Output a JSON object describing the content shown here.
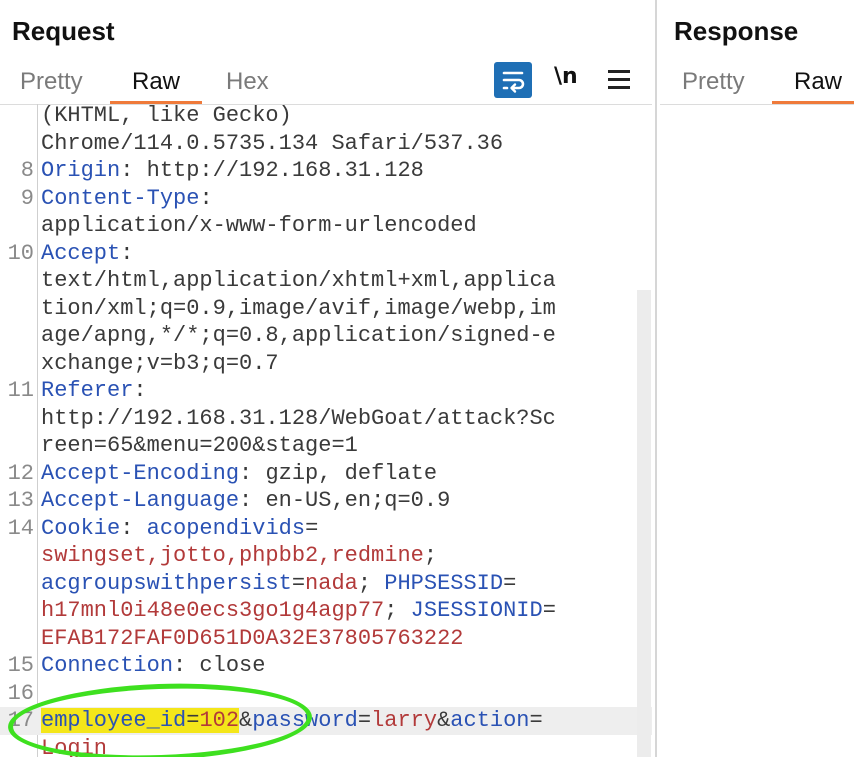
{
  "request": {
    "title": "Request",
    "tabs": [
      {
        "label": "Pretty",
        "active": false
      },
      {
        "label": "Raw",
        "active": true
      },
      {
        "label": "Hex",
        "active": false
      }
    ],
    "toolbar": {
      "newline_label": "\\n"
    }
  },
  "response": {
    "title": "Response",
    "tabs": [
      {
        "label": "Pretty",
        "active": false
      },
      {
        "label": "Raw",
        "active": true
      }
    ]
  },
  "lines": [
    {
      "n": "",
      "parts": [
        {
          "t": "(KHTML, like Gecko)",
          "c": "v"
        }
      ]
    },
    {
      "n": "",
      "parts": [
        {
          "t": "Chrome/114.0.5735.134 Safari/537.36",
          "c": "v"
        }
      ]
    },
    {
      "n": "8",
      "parts": [
        {
          "t": "Origin",
          "c": "k"
        },
        {
          "t": ": http://192.168.31.128",
          "c": "v"
        }
      ]
    },
    {
      "n": "9",
      "parts": [
        {
          "t": "Content-Type",
          "c": "k"
        },
        {
          "t": ":",
          "c": "v"
        }
      ]
    },
    {
      "n": "",
      "parts": [
        {
          "t": "application/x-www-form-urlencoded",
          "c": "v"
        }
      ]
    },
    {
      "n": "10",
      "parts": [
        {
          "t": "Accept",
          "c": "k"
        },
        {
          "t": ":",
          "c": "v"
        }
      ]
    },
    {
      "n": "",
      "parts": [
        {
          "t": "text/html,application/xhtml+xml,applica",
          "c": "v"
        }
      ]
    },
    {
      "n": "",
      "parts": [
        {
          "t": "tion/xml;q=0.9,image/avif,image/webp,im",
          "c": "v"
        }
      ]
    },
    {
      "n": "",
      "parts": [
        {
          "t": "age/apng,*/*;q=0.8,application/signed-e",
          "c": "v"
        }
      ]
    },
    {
      "n": "",
      "parts": [
        {
          "t": "xchange;v=b3;q=0.7",
          "c": "v"
        }
      ]
    },
    {
      "n": "11",
      "parts": [
        {
          "t": "Referer",
          "c": "k"
        },
        {
          "t": ":",
          "c": "v"
        }
      ]
    },
    {
      "n": "",
      "parts": [
        {
          "t": "http://192.168.31.128/WebGoat/attack?Sc",
          "c": "v"
        }
      ]
    },
    {
      "n": "",
      "parts": [
        {
          "t": "reen=65&menu=200&stage=1",
          "c": "v"
        }
      ]
    },
    {
      "n": "12",
      "parts": [
        {
          "t": "Accept-Encoding",
          "c": "k"
        },
        {
          "t": ": gzip, deflate",
          "c": "v"
        }
      ]
    },
    {
      "n": "13",
      "parts": [
        {
          "t": "Accept-Language",
          "c": "k"
        },
        {
          "t": ": en-US,en;q=0.9",
          "c": "v"
        }
      ]
    },
    {
      "n": "14",
      "parts": [
        {
          "t": "Cookie",
          "c": "k"
        },
        {
          "t": ": ",
          "c": "v"
        },
        {
          "t": "acopendivids",
          "c": "k"
        },
        {
          "t": "=",
          "c": "v"
        }
      ]
    },
    {
      "n": "",
      "parts": [
        {
          "t": "swingset,jotto,phpbb2,redmine",
          "c": "c"
        },
        {
          "t": ";",
          "c": "v"
        }
      ]
    },
    {
      "n": "",
      "parts": [
        {
          "t": "acgroupswithpersist",
          "c": "k"
        },
        {
          "t": "=",
          "c": "v"
        },
        {
          "t": "nada",
          "c": "c"
        },
        {
          "t": "; ",
          "c": "v"
        },
        {
          "t": "PHPSESSID",
          "c": "k"
        },
        {
          "t": "=",
          "c": "v"
        }
      ]
    },
    {
      "n": "",
      "parts": [
        {
          "t": "h17mnl0i48e0ecs3go1g4agp77",
          "c": "c"
        },
        {
          "t": "; ",
          "c": "v"
        },
        {
          "t": "JSESSIONID",
          "c": "k"
        },
        {
          "t": "=",
          "c": "v"
        }
      ]
    },
    {
      "n": "",
      "parts": [
        {
          "t": "EFAB172FAF0D651D0A32E37805763222",
          "c": "c"
        }
      ]
    },
    {
      "n": "15",
      "parts": [
        {
          "t": "Connection",
          "c": "k"
        },
        {
          "t": ": close",
          "c": "v"
        }
      ]
    },
    {
      "n": "16",
      "parts": []
    },
    {
      "n": "17",
      "highlight": true,
      "parts": [
        {
          "t": "employee_id",
          "c": "k",
          "y": true
        },
        {
          "t": "=",
          "c": "v",
          "y": true
        },
        {
          "t": "102",
          "c": "c",
          "y": true
        },
        {
          "t": "&",
          "c": "v"
        },
        {
          "t": "password",
          "c": "k"
        },
        {
          "t": "=",
          "c": "v"
        },
        {
          "t": "larry",
          "c": "c"
        },
        {
          "t": "&",
          "c": "v"
        },
        {
          "t": "action",
          "c": "k"
        },
        {
          "t": "=",
          "c": "v"
        }
      ]
    },
    {
      "n": "",
      "parts": [
        {
          "t": "Login",
          "c": "c"
        }
      ]
    }
  ],
  "annotation": {
    "color": "#3ee01f"
  },
  "colors": {
    "accent": "#ef7a3a",
    "wrap_button": "#1f6fb5",
    "key": "#2a52b4",
    "value": "#b23a3a",
    "highlight": "#f4e61a"
  }
}
